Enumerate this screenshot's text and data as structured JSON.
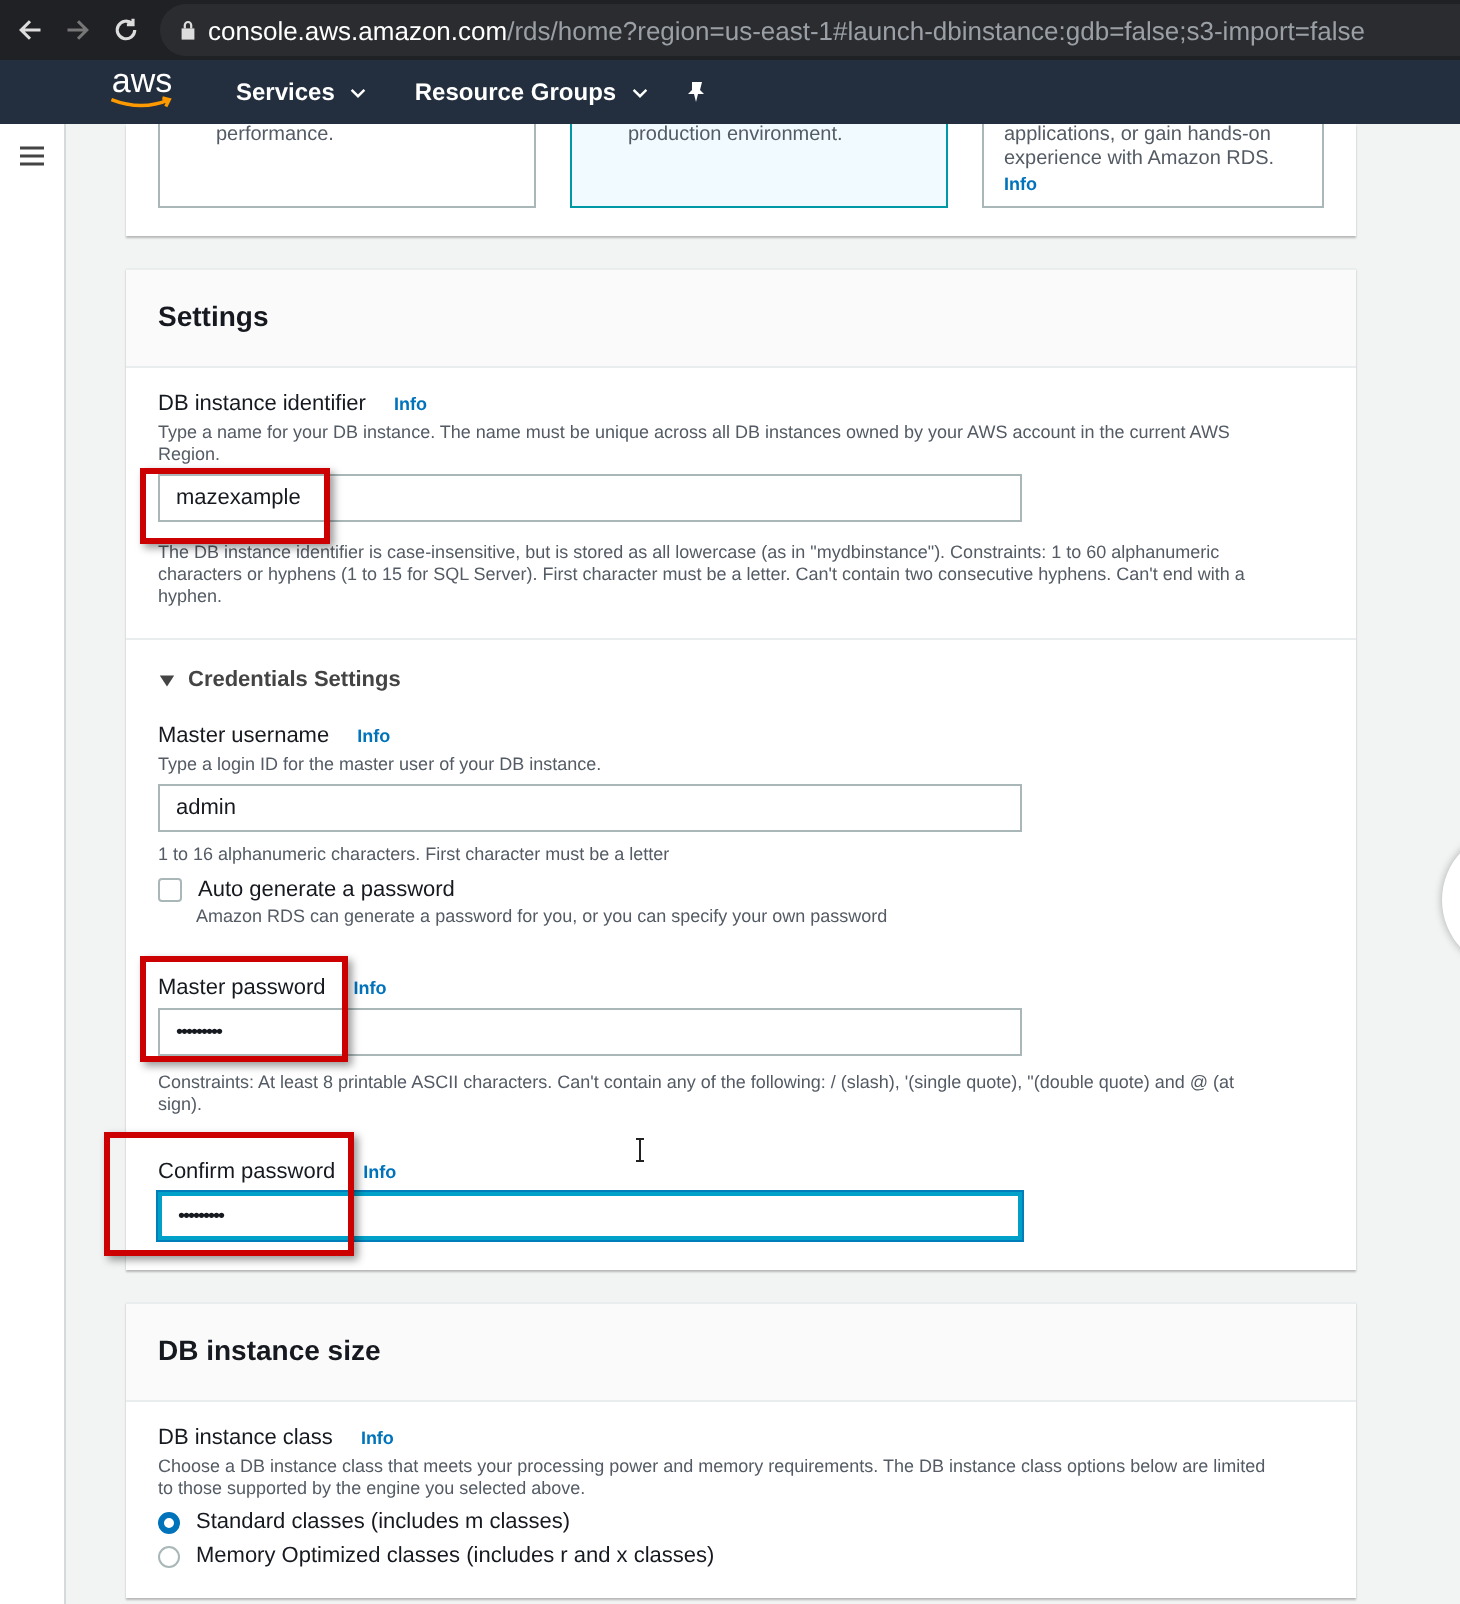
{
  "browser": {
    "url_host": "console.aws.amazon.com",
    "url_path": "/rds/home?region=us-east-1#launch-dbinstance:gdb=false;s3-import=false"
  },
  "nav": {
    "logo": "aws",
    "menus": [
      "Services",
      "Resource Groups"
    ]
  },
  "option_tiles": [
    {
      "lines": [
        "performance."
      ],
      "selected": false
    },
    {
      "lines": [
        "production environment."
      ],
      "selected": true
    },
    {
      "lines": [
        "applications, or gain hands-on",
        "experience with Amazon RDS."
      ],
      "selected": false,
      "info": "Info"
    }
  ],
  "settings": {
    "title": "Settings",
    "identifier": {
      "label": "DB instance identifier",
      "info": "Info",
      "description": "Type a name for your DB instance. The name must be unique across all DB instances owned by your AWS account in the current AWS Region.",
      "value": "mazexample",
      "constraint": "The DB instance identifier is case-insensitive, but is stored as all lowercase (as in \"mydbinstance\"). Constraints: 1 to 60 alphanumeric characters or hyphens (1 to 15 for SQL Server). First character must be a letter. Can't contain two consecutive hyphens. Can't end with a hyphen."
    },
    "credentials": {
      "title": "Credentials Settings",
      "expanded": true,
      "username": {
        "label": "Master username",
        "info": "Info",
        "description": "Type a login ID for the master user of your DB instance.",
        "value": "admin",
        "constraint": "1 to 16 alphanumeric characters. First character must be a letter"
      },
      "auto_generate": {
        "label": "Auto generate a password",
        "description": "Amazon RDS can generate a password for you, or you can specify your own password",
        "checked": false
      },
      "password": {
        "label": "Master password",
        "info": "Info",
        "value": "•••••••••",
        "constraint": "Constraints: At least 8 printable ASCII characters. Can't contain any of the following: / (slash), '(single quote), \"(double quote) and @ (at sign).",
        "focused": false
      },
      "confirm": {
        "label": "Confirm password",
        "info": "Info",
        "value": "•••••••••",
        "focused": true
      }
    }
  },
  "instance_size": {
    "title": "DB instance size",
    "class_label": "DB instance class",
    "info": "Info",
    "description": "Choose a DB instance class that meets your processing power and memory requirements. The DB instance class options below are limited to those supported by the engine you selected above.",
    "options": [
      {
        "label": "Standard classes (includes m classes)",
        "selected": true
      },
      {
        "label": "Memory Optimized classes (includes r and x classes)",
        "selected": false
      }
    ]
  }
}
